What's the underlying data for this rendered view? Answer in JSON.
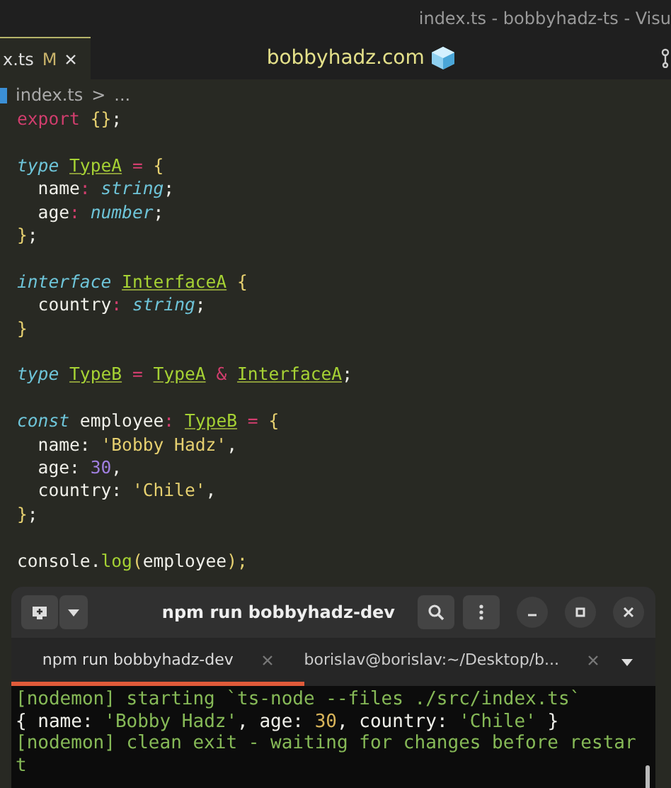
{
  "window": {
    "title": "index.ts - bobbyhadz-ts - Visu"
  },
  "editor_tab": {
    "label": "x.ts",
    "badge": "M",
    "selected": true
  },
  "banner": {
    "text": "bobbyhadz.com"
  },
  "breadcrumb": {
    "file": "index.ts",
    "separator": ">",
    "rest": "..."
  },
  "code_blocks": [
    [
      [
        {
          "text": "export",
          "kind": "keyword"
        },
        {
          "text": " {}",
          "kind": "brace"
        },
        {
          "text": ";",
          "kind": "plain"
        }
      ]
    ],
    [
      [
        {
          "text": "type ",
          "kind": "storage"
        },
        {
          "text": "TypeA",
          "kind": "type"
        },
        {
          "text": " = ",
          "kind": "op"
        },
        {
          "text": "{",
          "kind": "brace"
        }
      ],
      [
        {
          "text": "  name",
          "kind": "plain"
        },
        {
          "text": ": ",
          "kind": "op"
        },
        {
          "text": "string",
          "kind": "storage"
        },
        {
          "text": ";",
          "kind": "plain"
        }
      ],
      [
        {
          "text": "  age",
          "kind": "plain"
        },
        {
          "text": ": ",
          "kind": "op"
        },
        {
          "text": "number",
          "kind": "storage"
        },
        {
          "text": ";",
          "kind": "plain"
        }
      ],
      [
        {
          "text": "}",
          "kind": "brace"
        },
        {
          "text": ";",
          "kind": "plain"
        }
      ]
    ],
    [
      [
        {
          "text": "interface ",
          "kind": "storage"
        },
        {
          "text": "InterfaceA",
          "kind": "type"
        },
        {
          "text": " {",
          "kind": "brace"
        }
      ],
      [
        {
          "text": "  country",
          "kind": "plain"
        },
        {
          "text": ": ",
          "kind": "op"
        },
        {
          "text": "string",
          "kind": "storage"
        },
        {
          "text": ";",
          "kind": "plain"
        }
      ],
      [
        {
          "text": "}",
          "kind": "brace"
        }
      ]
    ],
    [
      [
        {
          "text": "type ",
          "kind": "storage"
        },
        {
          "text": "TypeB",
          "kind": "type"
        },
        {
          "text": " = ",
          "kind": "op"
        },
        {
          "text": "TypeA",
          "kind": "type"
        },
        {
          "text": " & ",
          "kind": "op"
        },
        {
          "text": "InterfaceA",
          "kind": "type"
        },
        {
          "text": ";",
          "kind": "plain"
        }
      ]
    ],
    [
      [
        {
          "text": "const",
          "kind": "storage"
        },
        {
          "text": " employee",
          "kind": "plain"
        },
        {
          "text": ": ",
          "kind": "op"
        },
        {
          "text": "TypeB",
          "kind": "type"
        },
        {
          "text": " = ",
          "kind": "op"
        },
        {
          "text": "{",
          "kind": "brace"
        }
      ],
      [
        {
          "text": "  name: ",
          "kind": "plain"
        },
        {
          "text": "'Bobby Hadz'",
          "kind": "string"
        },
        {
          "text": ",",
          "kind": "plain"
        }
      ],
      [
        {
          "text": "  age: ",
          "kind": "plain"
        },
        {
          "text": "30",
          "kind": "number"
        },
        {
          "text": ",",
          "kind": "plain"
        }
      ],
      [
        {
          "text": "  country: ",
          "kind": "plain"
        },
        {
          "text": "'Chile'",
          "kind": "string"
        },
        {
          "text": ",",
          "kind": "plain"
        }
      ],
      [
        {
          "text": "}",
          "kind": "brace"
        },
        {
          "text": ";",
          "kind": "plain"
        }
      ]
    ],
    [
      [
        {
          "text": "console.",
          "kind": "plain"
        },
        {
          "text": "log",
          "kind": "func"
        },
        {
          "text": "(",
          "kind": "brace"
        },
        {
          "text": "employee",
          "kind": "plain"
        },
        {
          "text": ");",
          "kind": "brace"
        }
      ]
    ]
  ],
  "terminal": {
    "title": "npm run bobbyhadz-dev",
    "tabs": [
      {
        "label": "npm run bobbyhadz-dev",
        "selected": true
      },
      {
        "label": "borislav@borislav:~/Desktop/b...",
        "selected": false
      }
    ],
    "lines": [
      [
        {
          "text": "[nodemon] starting `ts-node --files ./src/index.ts`",
          "kind": "info"
        }
      ],
      [
        {
          "text": "{ name: ",
          "kind": "plain"
        },
        {
          "text": "'Bobby Hadz'",
          "kind": "string"
        },
        {
          "text": ", age: ",
          "kind": "plain"
        },
        {
          "text": "30",
          "kind": "number"
        },
        {
          "text": ", country: ",
          "kind": "plain"
        },
        {
          "text": "'Chile'",
          "kind": "string"
        },
        {
          "text": " }",
          "kind": "plain"
        }
      ],
      [
        {
          "text": "[nodemon] clean exit - waiting for changes before restar",
          "kind": "info"
        }
      ],
      [
        {
          "text": "t",
          "kind": "info"
        }
      ]
    ]
  }
}
